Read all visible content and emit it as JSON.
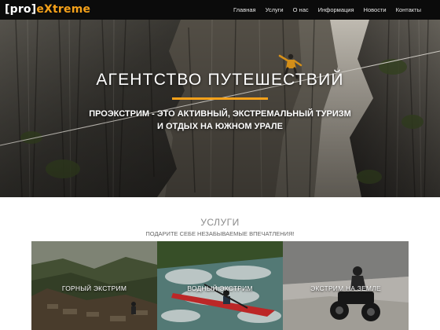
{
  "header": {
    "logo": {
      "bracket_part": "[pro]",
      "accent_part": "eXtreme"
    },
    "nav": [
      "Главная",
      "Услуги",
      "О нас",
      "Информация",
      "Новости",
      "Контакты"
    ]
  },
  "hero": {
    "title": "АГЕНТСТВО ПУТЕШЕСТВИЙ",
    "subtitle_line1": "ПРОЭКСТРИМ - ЭТО АКТИВНЫЙ, ЭКСТРЕМАЛЬНЫЙ ТУРИЗМ",
    "subtitle_line2": "И ОТДЫХ НА ЮЖНОМ УРАЛЕ"
  },
  "services": {
    "title": "УСЛУГИ",
    "subtitle": "ПОДАРИТЕ СЕБЕ НЕЗАБЫВАЕМЫЕ ВПЕЧАТЛЕНИЯ!",
    "cards": [
      {
        "label": "ГОРНЫЙ ЭКСТРИМ"
      },
      {
        "label": "ВОДНЫЙ ЭКСТРИМ"
      },
      {
        "label": "ЭКСТРИМ НА ЗЕМЛЕ"
      }
    ]
  },
  "colors": {
    "accent": "#f5a11a",
    "header_bg": "#0b0b0b"
  }
}
